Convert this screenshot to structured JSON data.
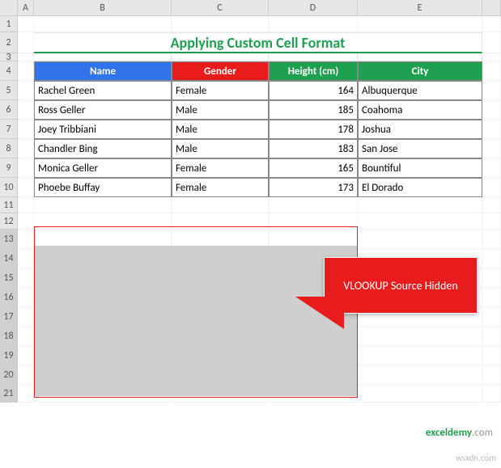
{
  "columns": [
    "A",
    "B",
    "C",
    "D",
    "E"
  ],
  "rows": [
    "1",
    "2",
    "3",
    "4",
    "5",
    "6",
    "7",
    "8",
    "9",
    "10",
    "11",
    "12",
    "13",
    "14",
    "15",
    "16",
    "17",
    "18",
    "19",
    "20",
    "21"
  ],
  "title": "Applying Custom Cell Format",
  "headers": {
    "name": "Name",
    "gender": "Gender",
    "height": "Height (cm)",
    "city": "City"
  },
  "people": [
    {
      "name": "Rachel Green",
      "gender": "Female",
      "height": "164",
      "city": "Albuquerque"
    },
    {
      "name": "Ross Geller",
      "gender": "Male",
      "height": "185",
      "city": "Coahoma"
    },
    {
      "name": "Joey Tribbiani",
      "gender": "Male",
      "height": "178",
      "city": "Joshua"
    },
    {
      "name": "Chandler Bing",
      "gender": "Male",
      "height": "183",
      "city": "San Jose"
    },
    {
      "name": "Monica Geller",
      "gender": "Female",
      "height": "165",
      "city": "Bountiful"
    },
    {
      "name": "Phoebe Buffay",
      "gender": "Female",
      "height": "173",
      "city": "El Dorado"
    }
  ],
  "callout": "VLOOKUP Source Hidden",
  "watermark": {
    "brand": "exceldemy",
    "suffix": ".com"
  },
  "source": "wsxdn.com"
}
